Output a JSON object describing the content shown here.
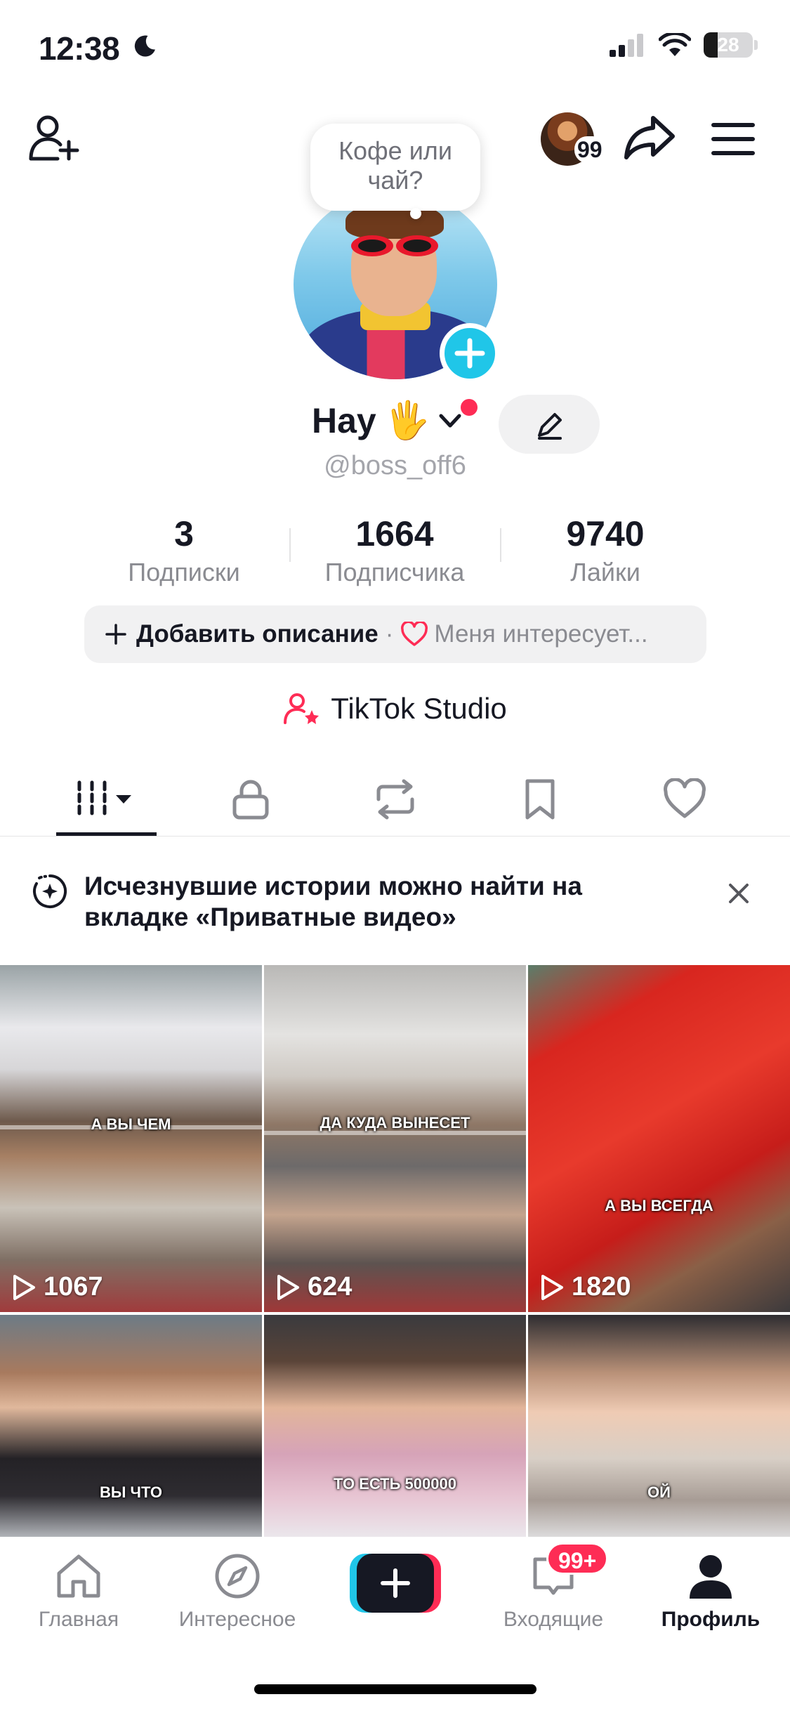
{
  "status_bar": {
    "time": "12:38",
    "battery": "28",
    "battery_level": 0.28
  },
  "header": {
    "notification_badge": "99",
    "icons": [
      "add-friend-icon",
      "share-icon",
      "menu-icon"
    ]
  },
  "profile": {
    "bubble": "Кофе или чай?",
    "name": "Hay",
    "emoji": "🖐",
    "handle": "@boss_off6",
    "stats": [
      {
        "value": "3",
        "label": "Подписки"
      },
      {
        "value": "1664",
        "label": "Подписчика"
      },
      {
        "value": "9740",
        "label": "Лайки"
      }
    ],
    "bio_add": "Добавить описание",
    "bio_sep": "·",
    "bio_interest": "Меня интересует...",
    "studio": "TikTok Studio"
  },
  "tabs": [
    "videos-tab",
    "private-tab",
    "reposts-tab",
    "favorites-tab",
    "liked-tab"
  ],
  "notice": {
    "text": "Исчезнувшие истории можно найти на вкладке «Приватные видео»"
  },
  "videos": [
    {
      "caption": "А ВЫ ЧЕМ",
      "views": "1067"
    },
    {
      "caption": "ДА КУДА ВЫНЕСЕТ",
      "views": "624"
    },
    {
      "caption": "А ВЫ ВСЕГДА",
      "views": "1820"
    },
    {
      "caption": "ВЫ ЧТО",
      "views": ""
    },
    {
      "caption": "ТО ЕСТЬ 500000",
      "views": ""
    },
    {
      "caption": "ОЙ",
      "views": ""
    }
  ],
  "bottom_nav": {
    "home": "Главная",
    "discover": "Интересное",
    "inbox": "Входящие",
    "inbox_badge": "99+",
    "profile": "Профиль"
  },
  "colors": {
    "accent": "#fe2c55",
    "cyan": "#20c6e8",
    "text": "#161823",
    "muted": "#8a8b91"
  }
}
